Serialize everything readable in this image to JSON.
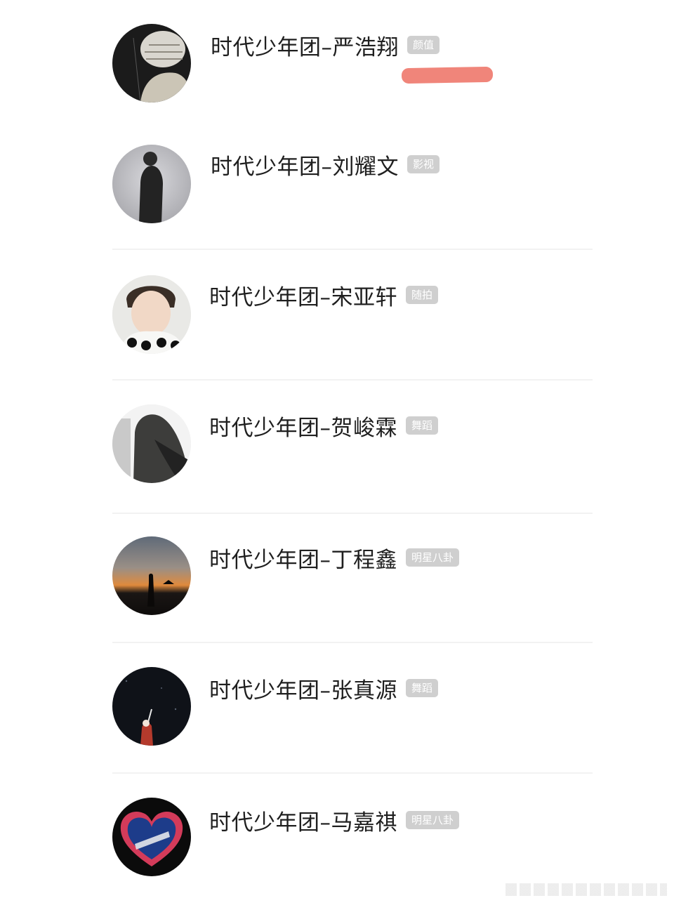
{
  "group_prefix": "时代少年团",
  "rows": [
    {
      "name": "时代少年团–严浩翔",
      "tag": "颜值"
    },
    {
      "name": "时代少年团–刘耀文",
      "tag": "影视"
    },
    {
      "name": "时代少年团–宋亚轩",
      "tag": "随拍"
    },
    {
      "name": "时代少年团–贺峻霖",
      "tag": "舞蹈"
    },
    {
      "name": "时代少年团–丁程鑫",
      "tag": "明星八卦"
    },
    {
      "name": "时代少年团–张真源",
      "tag": "舞蹈"
    },
    {
      "name": "时代少年团–马嘉祺",
      "tag": "明星八卦"
    }
  ],
  "colors": {
    "name_text": "#1f1f1f",
    "tag_bg": "#cfcfcf",
    "tag_text": "#ffffff",
    "highlight_mark": "#f0857a",
    "divider": "#f2f2f2"
  },
  "icons": [
    "avatar-photo"
  ]
}
